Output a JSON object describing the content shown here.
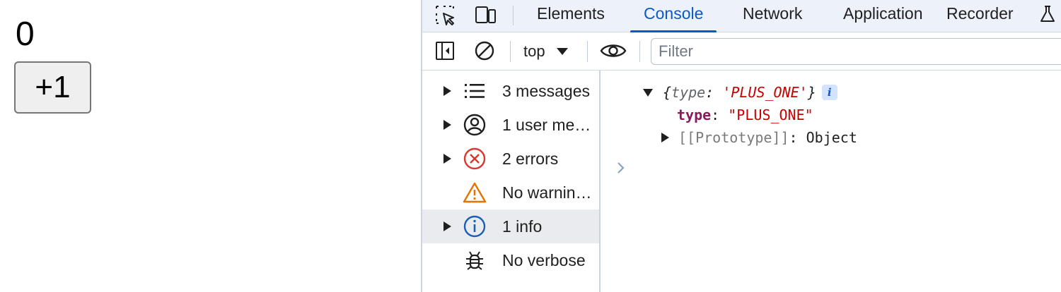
{
  "page": {
    "counter_value": "0",
    "plus_button_label": "+1"
  },
  "devtools": {
    "tabs": [
      {
        "label": "Elements",
        "active": false
      },
      {
        "label": "Console",
        "active": true
      },
      {
        "label": "Network",
        "active": false
      },
      {
        "label": "Application",
        "active": false
      },
      {
        "label": "Recorder",
        "active": false
      }
    ],
    "toolbar": {
      "context": "top",
      "filter_placeholder": "Filter"
    },
    "sidebar": {
      "items": [
        {
          "label": "3 messages",
          "icon": "list-icon",
          "expandable": true,
          "selected": false
        },
        {
          "label": "1 user me…",
          "icon": "user-icon",
          "expandable": true,
          "selected": false
        },
        {
          "label": "2 errors",
          "icon": "error-icon",
          "expandable": true,
          "selected": false
        },
        {
          "label": "No warnin…",
          "icon": "warning-icon",
          "expandable": false,
          "selected": false
        },
        {
          "label": "1 info",
          "icon": "info-icon",
          "expandable": true,
          "selected": true
        },
        {
          "label": "No verbose",
          "icon": "bug-icon",
          "expandable": false,
          "selected": false
        }
      ]
    },
    "console": {
      "object_open": "{",
      "object_key": "type",
      "object_colon": ": ",
      "object_value": "'PLUS_ONE'",
      "object_close": "}",
      "info_badge": "i",
      "prop_name": "type",
      "prop_colon": ": ",
      "prop_value": "\"PLUS_ONE\"",
      "proto_name": "[[Prototype]]",
      "proto_colon": ": ",
      "proto_value": "Object"
    },
    "colors": {
      "accent": "#0b57d0",
      "error": "#dc362e",
      "warning": "#e37400",
      "string": "#c80000",
      "property": "#8a1b5b"
    }
  }
}
